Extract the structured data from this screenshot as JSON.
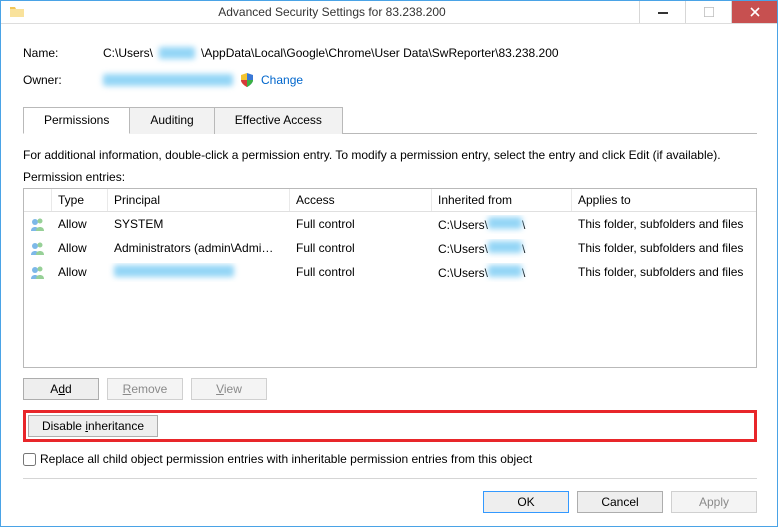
{
  "window": {
    "title": "Advanced Security Settings for 83.238.200"
  },
  "fields": {
    "name_label": "Name:",
    "name_value": "C:\\Users\\███\\AppData\\Local\\Google\\Chrome\\User Data\\SwReporter\\83.238.200",
    "owner_label": "Owner:",
    "owner_value": "████████████",
    "change_link": "Change"
  },
  "tabs": {
    "permissions": "Permissions",
    "auditing": "Auditing",
    "effective": "Effective Access"
  },
  "info_text": "For additional information, double-click a permission entry. To modify a permission entry, select the entry and click Edit (if available).",
  "entries_label": "Permission entries:",
  "columns": {
    "type": "Type",
    "principal": "Principal",
    "access": "Access",
    "inherited": "Inherited from",
    "applies": "Applies to"
  },
  "rows": [
    {
      "type": "Allow",
      "principal": "SYSTEM",
      "access": "Full control",
      "inherited": "C:\\Users\\███\\",
      "applies": "This folder, subfolders and files"
    },
    {
      "type": "Allow",
      "principal": "Administrators (admin\\Admi…",
      "access": "Full control",
      "inherited": "C:\\Users\\███\\",
      "applies": "This folder, subfolders and files"
    },
    {
      "type": "Allow",
      "principal": "████████████",
      "access": "Full control",
      "inherited": "C:\\Users\\███\\",
      "applies": "This folder, subfolders and files"
    }
  ],
  "buttons": {
    "add": "Add",
    "remove": "Remove",
    "view": "View",
    "disable": "Disable inheritance",
    "ok": "OK",
    "cancel": "Cancel",
    "apply": "Apply"
  },
  "checkbox_label": "Replace all child object permission entries with inheritable permission entries from this object"
}
